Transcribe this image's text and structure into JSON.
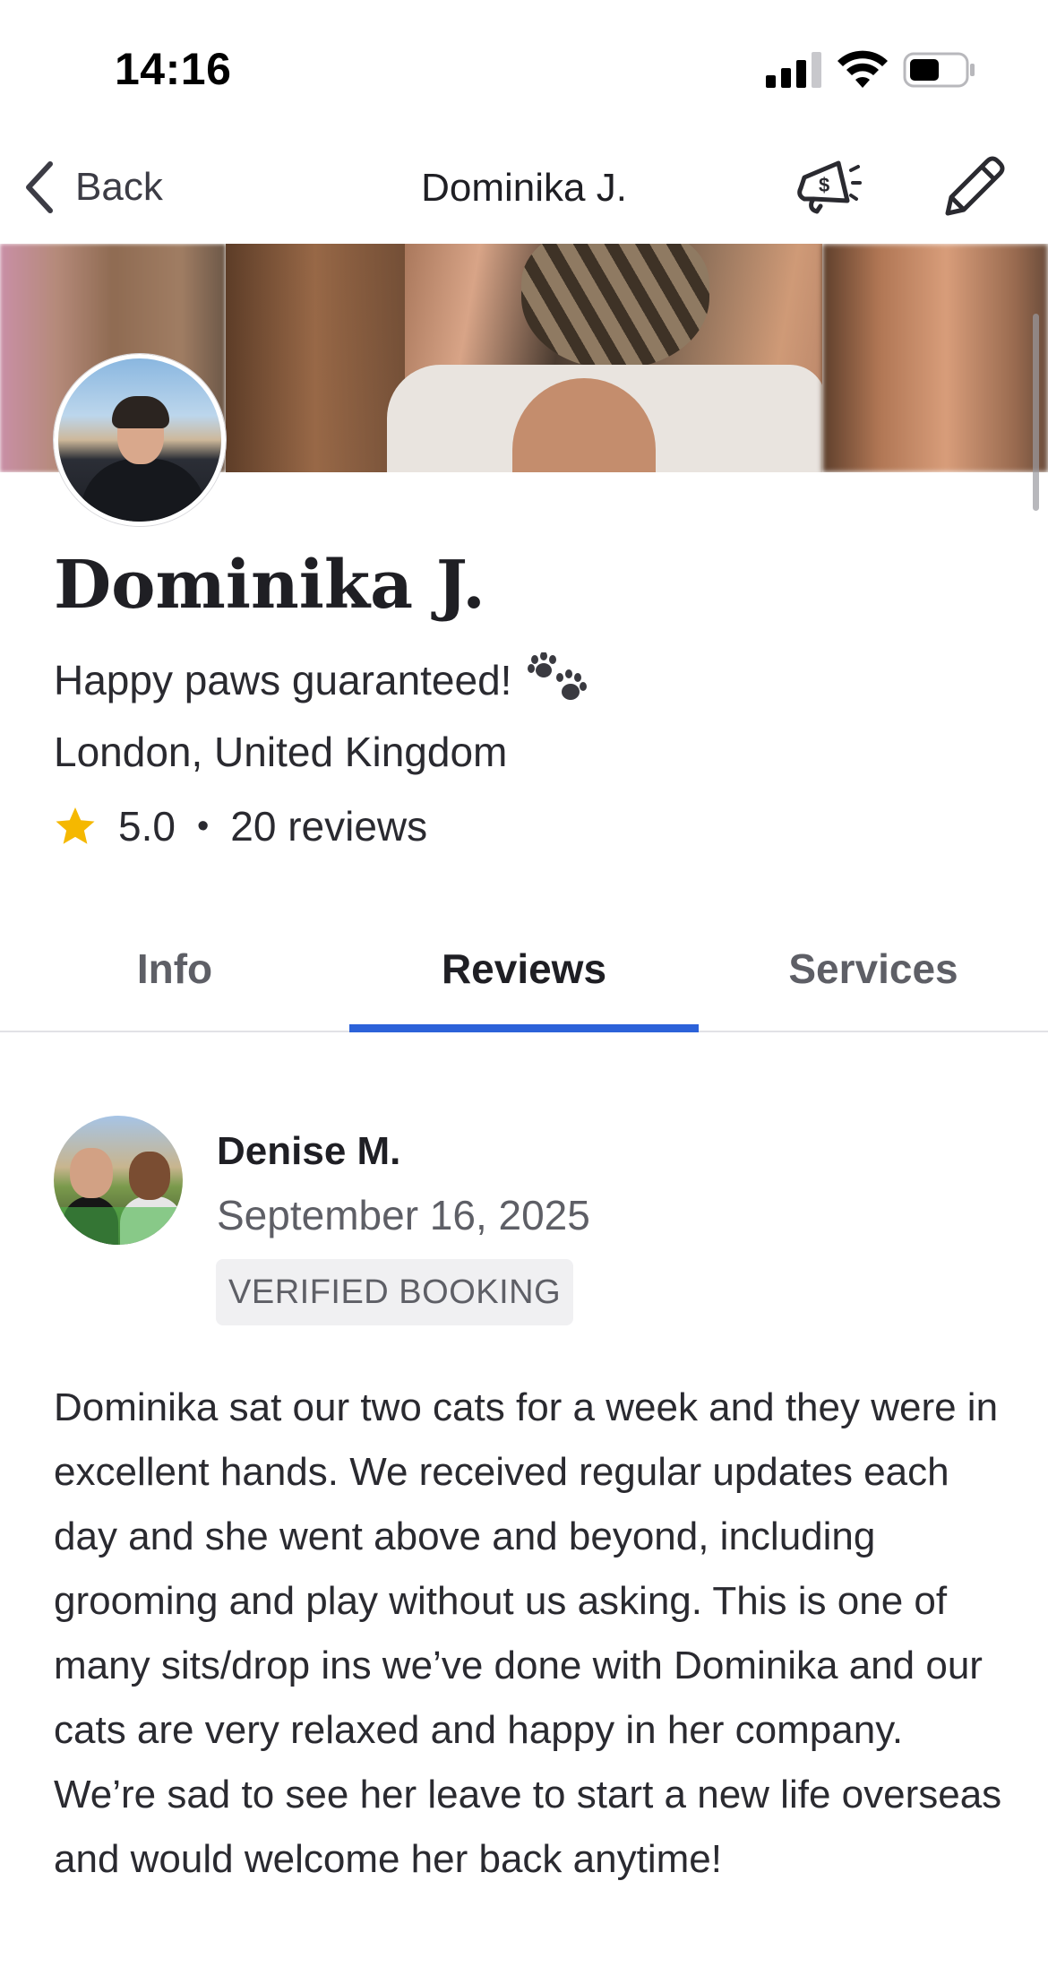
{
  "status_bar": {
    "time": "14:16"
  },
  "nav": {
    "back_label": "Back",
    "title": "Dominika J."
  },
  "profile": {
    "name": "Dominika J.",
    "tagline": "Happy paws guaranteed!",
    "location": "London, United Kingdom",
    "rating": "5.0",
    "separator": "•",
    "reviews_count": "20 reviews",
    "star_color": "#F5B800"
  },
  "tabs": [
    {
      "label": "Info",
      "active": false
    },
    {
      "label": "Reviews",
      "active": true
    },
    {
      "label": "Services",
      "active": false
    }
  ],
  "accent_color": "#2C62D9",
  "review": {
    "reviewer_name": "Denise M.",
    "date": "September 16, 2025",
    "badge": "VERIFIED BOOKING",
    "text": "Dominika sat our two cats for a week and they were in excellent hands. We received regular updates each day and she went above and beyond, including grooming and play without us asking. This is one of many sits/drop ins we’ve done with Dominika and our cats are very relaxed and happy in her company. We’re sad to see her leave to start a new life overseas and would welcome her back anytime!"
  }
}
